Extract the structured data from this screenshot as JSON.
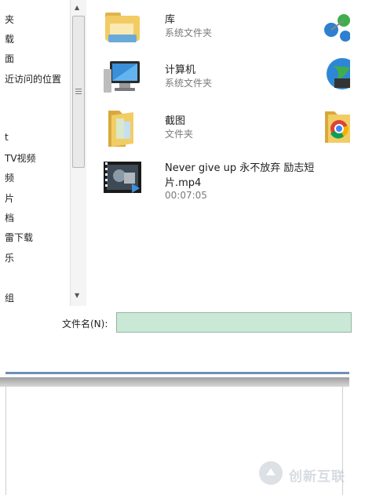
{
  "nav": {
    "items": [
      "夹",
      "载",
      "面",
      "近访问的位置",
      "t",
      "TV视频",
      "频",
      "片",
      "档",
      "雷下载",
      "乐",
      "组"
    ]
  },
  "content": {
    "files": [
      {
        "name": "库",
        "type": "系统文件夹",
        "icon": "library-folder-icon"
      },
      {
        "name": "计算机",
        "type": "系统文件夹",
        "icon": "computer-icon"
      },
      {
        "name": "截图",
        "type": "文件夹",
        "icon": "folder-icon"
      },
      {
        "name_line1": "Never give up 永不放弃 励志短",
        "name_line2": "片.mp4",
        "duration": "00:07:05",
        "icon": "video-thumbnail-icon"
      }
    ],
    "edge_icons": [
      "network-icon",
      "globe-icon",
      "chrome-folder-icon"
    ]
  },
  "filename": {
    "label": "文件名(N):",
    "value": ""
  },
  "watermark": {
    "text": "创新互联"
  },
  "colors": {
    "input_bg": "#c9e8d5",
    "frame": "#6f8fb5",
    "folder": "#e8c35a"
  }
}
